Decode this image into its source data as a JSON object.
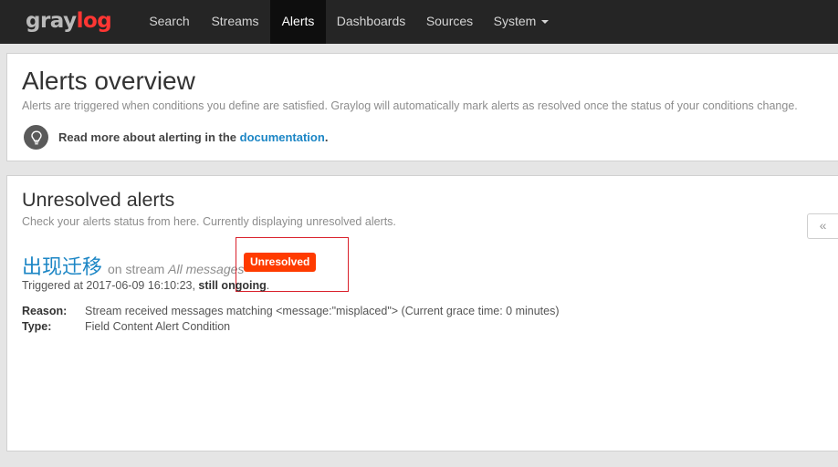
{
  "brand": {
    "part1": "gray",
    "part2": "log"
  },
  "nav": {
    "items": [
      {
        "label": "Search"
      },
      {
        "label": "Streams"
      },
      {
        "label": "Alerts"
      },
      {
        "label": "Dashboards"
      },
      {
        "label": "Sources"
      },
      {
        "label": "System"
      }
    ],
    "active": "Alerts"
  },
  "overview": {
    "title": "Alerts overview",
    "description": "Alerts are triggered when conditions you define are satisfied. Graylog will automatically mark alerts as resolved once the status of your conditions change.",
    "tip_prefix": "Read more about alerting in the ",
    "tip_link": "documentation",
    "tip_suffix": ".",
    "tip_icon": "lightbulb-icon"
  },
  "unresolved": {
    "title": "Unresolved alerts",
    "description": "Check your alerts status from here. Currently displaying unresolved alerts.",
    "alert": {
      "title": "出现迁移",
      "on_stream_label": "on stream",
      "stream_name": "All messages",
      "status_badge": "Unresolved",
      "triggered_prefix": "Triggered at 2017-06-09 16:10:23, ",
      "triggered_strong": "still ongoing",
      "triggered_suffix": ".",
      "reason_label": "Reason:",
      "reason_value": "Stream received messages matching <message:\"misplaced\"> (Current grace time: 0 minutes)",
      "type_label": "Type:",
      "type_value": "Field Content Alert Condition"
    }
  },
  "collapse_button": "«",
  "colors": {
    "navbar_bg": "#252525",
    "active_tab_bg": "#0e0e0e",
    "link": "#1c86c5",
    "badge_bg": "#ff3b00",
    "brand_accent": "#ff3633",
    "highlight_border": "#d9202b"
  }
}
